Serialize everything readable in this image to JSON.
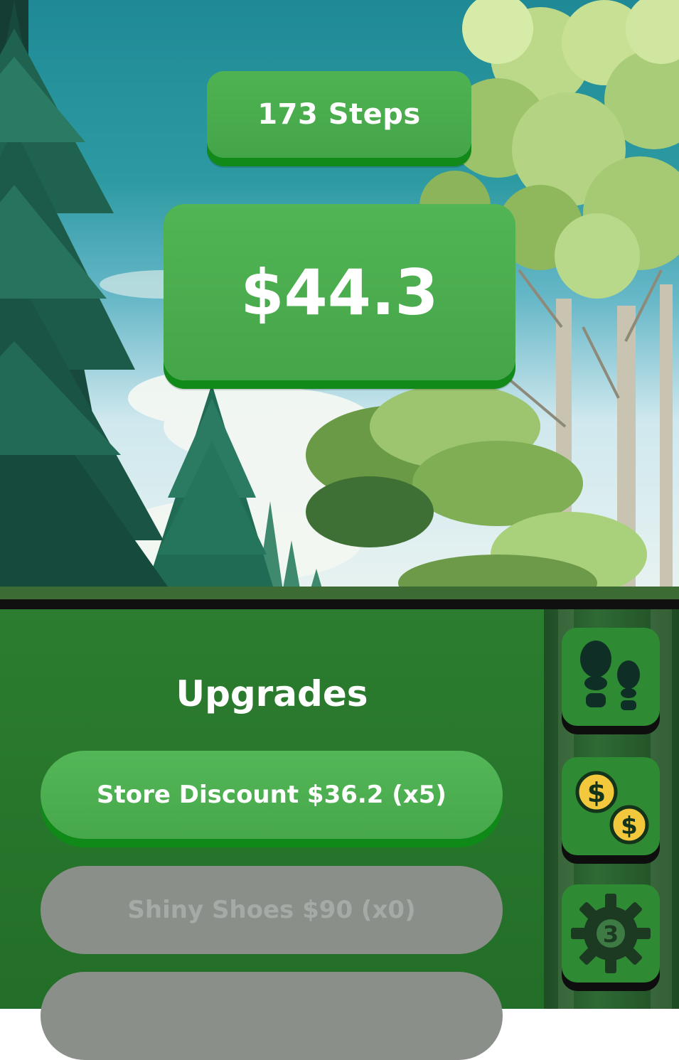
{
  "hud": {
    "steps_label": "173 Steps",
    "money_label": "$44.3"
  },
  "upgrades": {
    "title": "Upgrades",
    "items": [
      {
        "label": "Store Discount $36.2 (x5)",
        "enabled": true
      },
      {
        "label": "Shiny Shoes $90 (x0)",
        "enabled": false
      },
      {
        "label": "",
        "enabled": false
      }
    ]
  },
  "side_nav": {
    "items": [
      {
        "icon": "footprints-icon"
      },
      {
        "icon": "coins-icon"
      },
      {
        "icon": "gear-icon",
        "badge": "3"
      }
    ]
  },
  "colors": {
    "button_green": "#4caf50",
    "button_shadow": "#118a1a",
    "panel_green": "#2a7a2f",
    "disabled_gray": "#8a8f8a",
    "coin_yellow": "#f3c83c"
  }
}
